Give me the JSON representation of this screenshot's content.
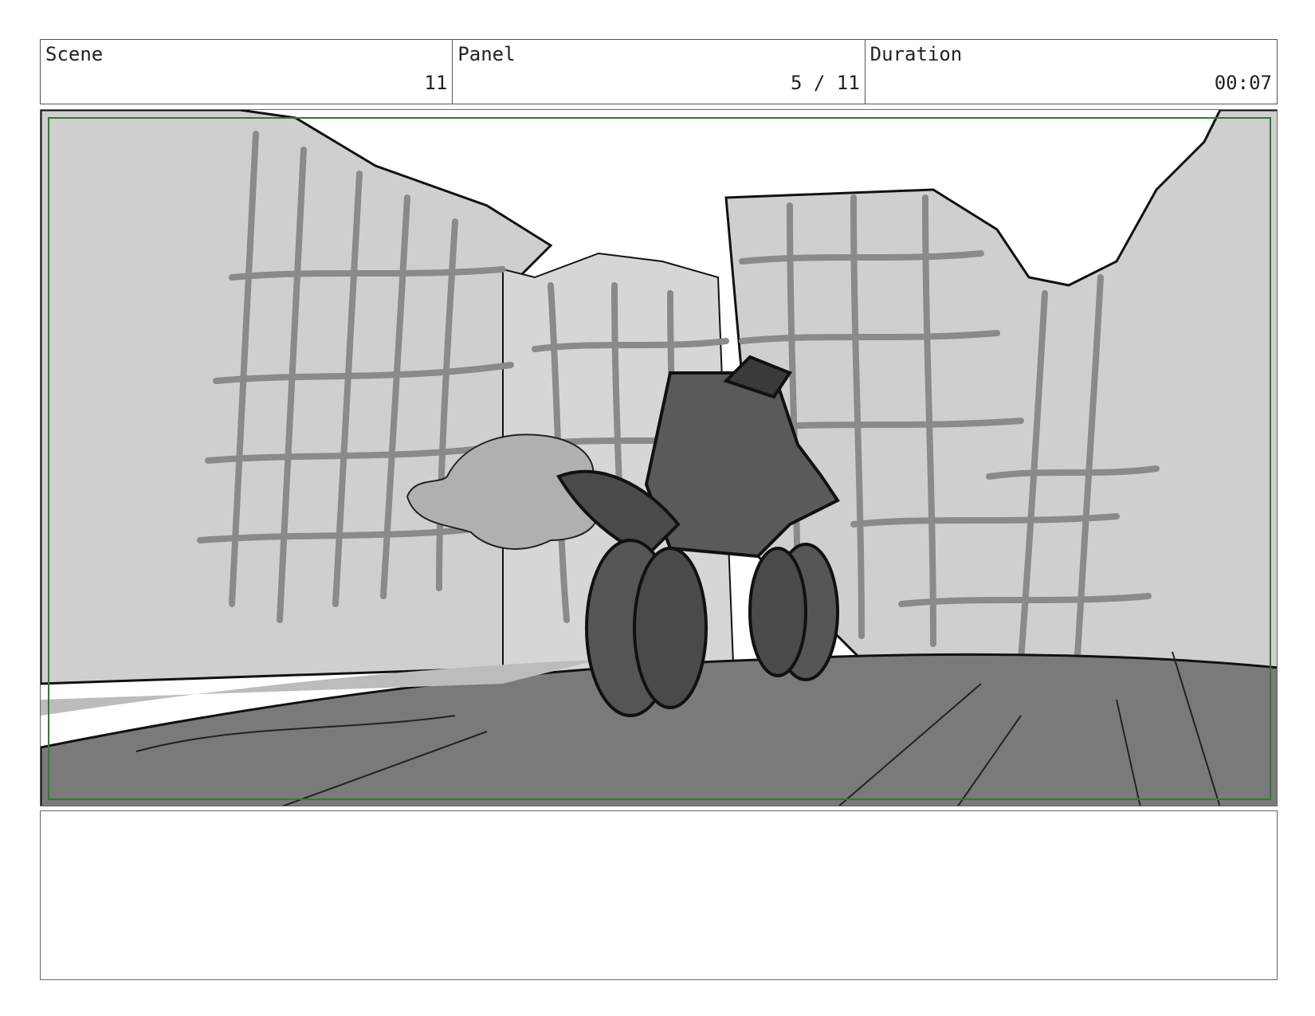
{
  "header": {
    "scene_label": "Scene",
    "scene_value": "11",
    "panel_label": "Panel",
    "panel_value": "5 / 11",
    "duration_label": "Duration",
    "duration_value": "00:07"
  },
  "notes": {
    "text": ""
  },
  "colors": {
    "safe_frame": "#2e7d32",
    "sky": "#ffffff",
    "cliff": "#cfcfcf",
    "grid": "#8a8a8a",
    "road": "#7a7a7a",
    "vehicle": "#5a5a5a"
  }
}
